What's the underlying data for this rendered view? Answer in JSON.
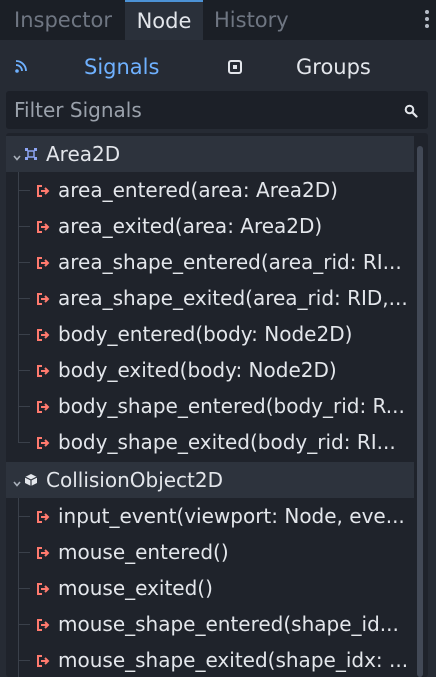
{
  "tabs": {
    "inspector": "Inspector",
    "node": "Node",
    "history": "History"
  },
  "subtabs": {
    "signals": "Signals",
    "groups": "Groups"
  },
  "filter": {
    "placeholder": "Filter Signals"
  },
  "groups": [
    {
      "name": "Area2D",
      "icon": "area2d-icon",
      "signals": [
        "area_entered(area: Area2D)",
        "area_exited(area: Area2D)",
        "area_shape_entered(area_rid: RI...",
        "area_shape_exited(area_rid: RID,...",
        "body_entered(body: Node2D)",
        "body_exited(body: Node2D)",
        "body_shape_entered(body_rid: R...",
        "body_shape_exited(body_rid: RI..."
      ]
    },
    {
      "name": "CollisionObject2D",
      "icon": "collision-object-icon",
      "signals": [
        "input_event(viewport: Node, eve...",
        "mouse_entered()",
        "mouse_exited()",
        "mouse_shape_entered(shape_id...",
        "mouse_shape_exited(shape_idx: ..."
      ]
    }
  ],
  "colors": {
    "accent": "#6fb1ff",
    "signal_icon": "#ff7a6e",
    "group_icon_area": "#8da5f3",
    "background": "#21262e"
  }
}
